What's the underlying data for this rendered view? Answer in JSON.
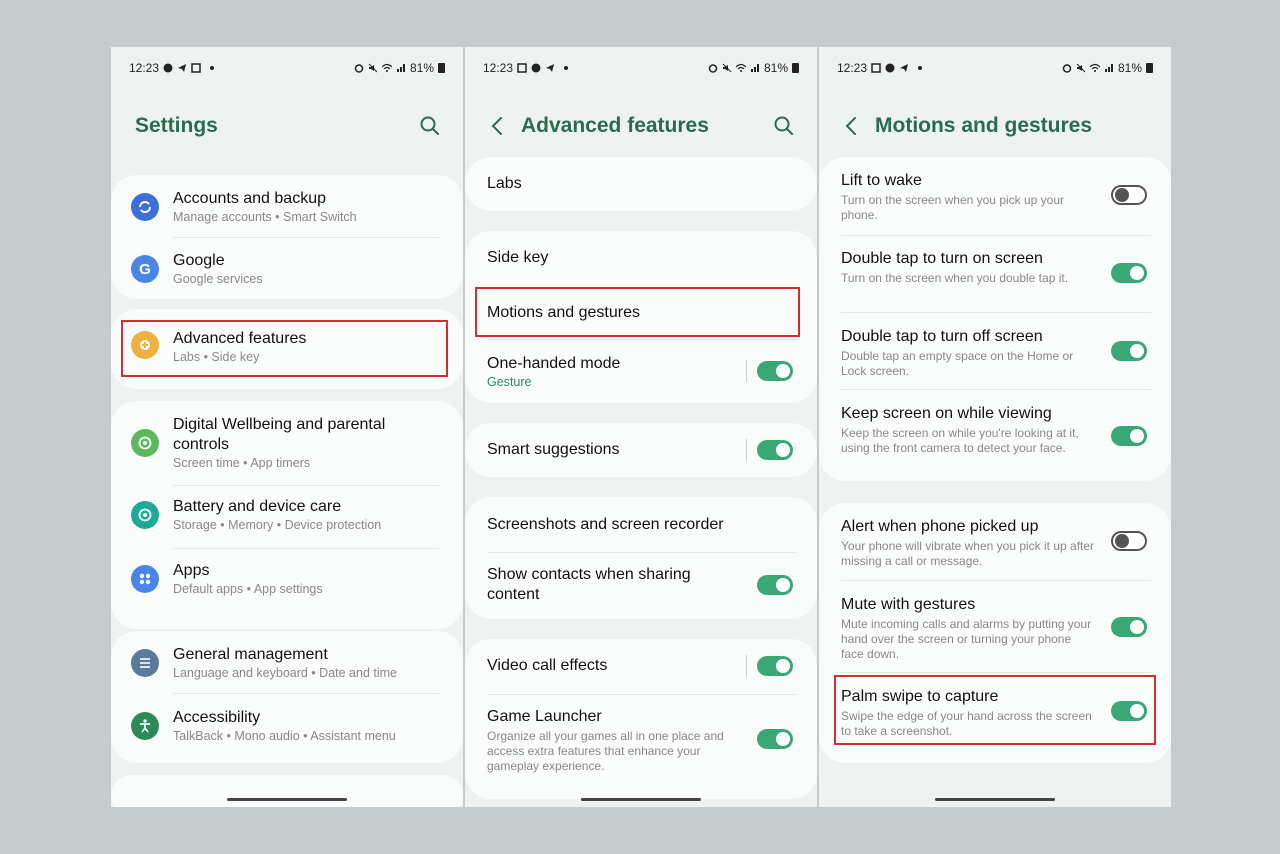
{
  "status": {
    "time": "12:23",
    "battery": "81%"
  },
  "panel1": {
    "title": "Settings",
    "items": [
      {
        "title": "Accounts and backup",
        "sub": "Manage accounts  •  Smart Switch",
        "color": "#3b6fd9"
      },
      {
        "title": "Google",
        "sub": "Google services",
        "color": "#4a86e8"
      },
      {
        "title": "Advanced features",
        "sub": "Labs  •  Side key",
        "color": "#f0b040"
      },
      {
        "title": "Digital Wellbeing and parental controls",
        "sub": "Screen time  •  App timers",
        "color": "#5cb85c"
      },
      {
        "title": "Battery and device care",
        "sub": "Storage  •  Memory  •  Device protection",
        "color": "#1ea896"
      },
      {
        "title": "Apps",
        "sub": "Default apps  •  App settings",
        "color": "#4a86e8"
      },
      {
        "title": "General management",
        "sub": "Language and keyboard  •  Date and time",
        "color": "#5a7a99"
      },
      {
        "title": "Accessibility",
        "sub": "TalkBack  •  Mono audio  •  Assistant menu",
        "color": "#2e8b57"
      }
    ]
  },
  "panel2": {
    "title": "Advanced features",
    "items": [
      {
        "title": "Labs"
      },
      {
        "title": "Side key"
      },
      {
        "title": "Motions and gestures"
      },
      {
        "title": "One-handed mode",
        "sub": "Gesture",
        "toggle": "on"
      },
      {
        "title": "Smart suggestions",
        "toggle": "on"
      },
      {
        "title": "Screenshots and screen recorder"
      },
      {
        "title": "Show contacts when sharing content",
        "toggle": "on"
      },
      {
        "title": "Video call effects",
        "toggle": "on"
      },
      {
        "title": "Game Launcher",
        "sub": "Organize all your games all in one place and access extra features that enhance your gameplay experience.",
        "toggle": "on"
      }
    ]
  },
  "panel3": {
    "title": "Motions and gestures",
    "items": [
      {
        "title": "Lift to wake",
        "sub": "Turn on the screen when you pick up your phone.",
        "toggle": "off"
      },
      {
        "title": "Double tap to turn on screen",
        "sub": "Turn on the screen when you double tap it.",
        "toggle": "on"
      },
      {
        "title": "Double tap to turn off screen",
        "sub": "Double tap an empty space on the Home or Lock screen.",
        "toggle": "on"
      },
      {
        "title": "Keep screen on while viewing",
        "sub": "Keep the screen on while you're looking at it, using the front camera to detect your face.",
        "toggle": "on"
      },
      {
        "title": "Alert when phone picked up",
        "sub": "Your phone will vibrate when you pick it up after missing a call or message.",
        "toggle": "off"
      },
      {
        "title": "Mute with gestures",
        "sub": "Mute incoming calls and alarms by putting your hand over the screen or turning your phone face down.",
        "toggle": "on"
      },
      {
        "title": "Palm swipe to capture",
        "sub": "Swipe the edge of your hand across the screen to take a screenshot.",
        "toggle": "on"
      }
    ]
  },
  "colors": {
    "accent": "#2a6b52",
    "toggle_on": "#3aa876",
    "highlight": "#d32f2f"
  }
}
